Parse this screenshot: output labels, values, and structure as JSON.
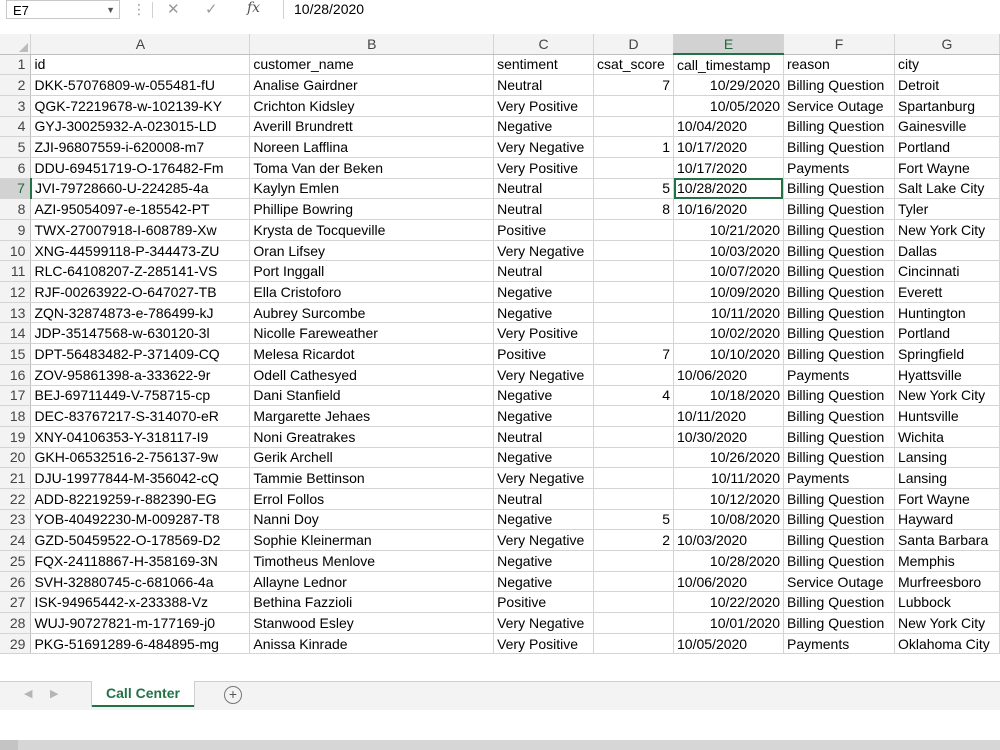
{
  "formula_bar": {
    "name_box": "E7",
    "cancel_icon": "✕",
    "enter_icon": "✓",
    "fx_label": "fx",
    "value": "10/28/2020"
  },
  "columns": [
    "A",
    "B",
    "C",
    "D",
    "E",
    "F",
    "G"
  ],
  "selected_column": "E",
  "selected_row": 7,
  "rows": [
    [
      "id",
      "customer_name",
      "sentiment",
      "csat_score",
      "call_timestamp",
      "reason",
      "city"
    ],
    [
      "DKK-57076809-w-055481-fU",
      "Analise Gairdner",
      "Neutral",
      "7",
      "10/29/2020",
      "Billing Question",
      "Detroit"
    ],
    [
      "QGK-72219678-w-102139-KY",
      "Crichton Kidsley",
      "Very Positive",
      "",
      "10/05/2020",
      "Service Outage",
      "Spartanburg"
    ],
    [
      "GYJ-30025932-A-023015-LD",
      "Averill Brundrett",
      "Negative",
      "",
      "10/04/2020",
      "Billing Question",
      "Gainesville"
    ],
    [
      "ZJI-96807559-i-620008-m7",
      "Noreen Lafflina",
      "Very Negative",
      "1",
      "10/17/2020",
      "Billing Question",
      "Portland"
    ],
    [
      "DDU-69451719-O-176482-Fm",
      "Toma Van der Beken",
      "Very Positive",
      "",
      "10/17/2020",
      "Payments",
      "Fort Wayne"
    ],
    [
      "JVI-79728660-U-224285-4a",
      "Kaylyn Emlen",
      "Neutral",
      "5",
      "10/28/2020",
      "Billing Question",
      "Salt Lake City"
    ],
    [
      "AZI-95054097-e-185542-PT",
      "Phillipe Bowring",
      "Neutral",
      "8",
      "10/16/2020",
      "Billing Question",
      "Tyler"
    ],
    [
      "TWX-27007918-I-608789-Xw",
      "Krysta de Tocqueville",
      "Positive",
      "",
      "10/21/2020",
      "Billing Question",
      "New York City"
    ],
    [
      "XNG-44599118-P-344473-ZU",
      "Oran Lifsey",
      "Very Negative",
      "",
      "10/03/2020",
      "Billing Question",
      "Dallas"
    ],
    [
      "RLC-64108207-Z-285141-VS",
      "Port Inggall",
      "Neutral",
      "",
      "10/07/2020",
      "Billing Question",
      "Cincinnati"
    ],
    [
      "RJF-00263922-O-647027-TB",
      "Ella Cristoforo",
      "Negative",
      "",
      "10/09/2020",
      "Billing Question",
      "Everett"
    ],
    [
      "ZQN-32874873-e-786499-kJ",
      "Aubrey Surcombe",
      "Negative",
      "",
      "10/11/2020",
      "Billing Question",
      "Huntington"
    ],
    [
      "JDP-35147568-w-630120-3l",
      "Nicolle Fareweather",
      "Very Positive",
      "",
      "10/02/2020",
      "Billing Question",
      "Portland"
    ],
    [
      "DPT-56483482-P-371409-CQ",
      "Melesa Ricardot",
      "Positive",
      "7",
      "10/10/2020",
      "Billing Question",
      "Springfield"
    ],
    [
      "ZOV-95861398-a-333622-9r",
      "Odell Cathesyed",
      "Very Negative",
      "",
      "10/06/2020",
      "Payments",
      "Hyattsville"
    ],
    [
      "BEJ-69711449-V-758715-cp",
      "Dani Stanfield",
      "Negative",
      "4",
      "10/18/2020",
      "Billing Question",
      "New York City"
    ],
    [
      "DEC-83767217-S-314070-eR",
      "Margarette Jehaes",
      "Negative",
      "",
      "10/11/2020",
      "Billing Question",
      "Huntsville"
    ],
    [
      "XNY-04106353-Y-318117-I9",
      "Noni Greatrakes",
      "Neutral",
      "",
      "10/30/2020",
      "Billing Question",
      "Wichita"
    ],
    [
      "GKH-06532516-2-756137-9w",
      "Gerik Archell",
      "Negative",
      "",
      "10/26/2020",
      "Billing Question",
      "Lansing"
    ],
    [
      "DJU-19977844-M-356042-cQ",
      "Tammie Bettinson",
      "Very Negative",
      "",
      "10/11/2020",
      "Payments",
      "Lansing"
    ],
    [
      "ADD-82219259-r-882390-EG",
      "Errol Follos",
      "Neutral",
      "",
      "10/12/2020",
      "Billing Question",
      "Fort Wayne"
    ],
    [
      "YOB-40492230-M-009287-T8",
      "Nanni Doy",
      "Negative",
      "5",
      "10/08/2020",
      "Billing Question",
      "Hayward"
    ],
    [
      "GZD-50459522-O-178569-D2",
      "Sophie Kleinerman",
      "Very Negative",
      "2",
      "10/03/2020",
      "Billing Question",
      "Santa Barbara"
    ],
    [
      "FQX-24118867-H-358169-3N",
      "Timotheus Menlove",
      "Negative",
      "",
      "10/28/2020",
      "Billing Question",
      "Memphis"
    ],
    [
      "SVH-32880745-c-681066-4a",
      "Allayne Lednor",
      "Negative",
      "",
      "10/06/2020",
      "Service Outage",
      "Murfreesboro"
    ],
    [
      "ISK-94965442-x-233388-Vz",
      "Bethina Fazzioli",
      "Positive",
      "",
      "10/22/2020",
      "Billing Question",
      "Lubbock"
    ],
    [
      "WUJ-90727821-m-177169-j0",
      "Stanwood Esley",
      "Very Negative",
      "",
      "10/01/2020",
      "Billing Question",
      "New York City"
    ],
    [
      "PKG-51691289-6-484895-mg",
      "Anissa Kinrade",
      "Very Positive",
      "",
      "10/05/2020",
      "Payments",
      "Oklahoma City"
    ]
  ],
  "right_aligned_dates": [
    2,
    3,
    9,
    10,
    11,
    12,
    13,
    14,
    15,
    17,
    20,
    21,
    22,
    23,
    25,
    27,
    28
  ],
  "sheet_tabs": [
    "Call Center"
  ],
  "add_sheet_icon": "+",
  "tab_nav": {
    "prev": "◀",
    "next": "▶"
  }
}
